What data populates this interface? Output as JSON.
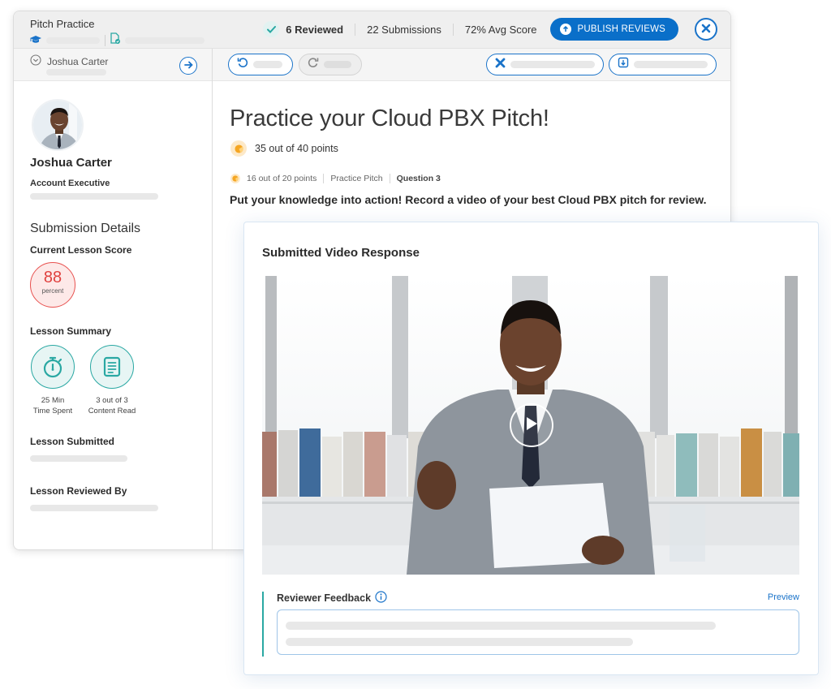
{
  "window": {
    "app_title": "Pitch Practice",
    "breadcrumb_icons": [
      "graduation-cap-icon",
      "document-check-icon"
    ]
  },
  "header_stats": {
    "reviewed": "6 Reviewed",
    "submissions": "22 Submissions",
    "avg_score": "72% Avg Score",
    "publish_label": "PUBLISH REVIEWS",
    "close_icon": "close-icon"
  },
  "sidebar": {
    "learner_select": "Joshua Carter",
    "profile": {
      "name": "Joshua Carter",
      "role": "Account Executive"
    },
    "section_title": "Submission Details",
    "current_score": {
      "label": "Current Lesson Score",
      "value": "88",
      "unit": "percent"
    },
    "summary": {
      "label": "Lesson Summary",
      "items": [
        {
          "icon": "stopwatch-icon",
          "value": "25 Min",
          "caption": "Time Spent"
        },
        {
          "icon": "document-icon",
          "value": "3 out of 3",
          "caption": "Content Read"
        }
      ]
    },
    "submitted_label": "Lesson Submitted",
    "reviewed_by_label": "Lesson Reviewed By"
  },
  "toolbar": {
    "buttons": [
      {
        "icon": "undo-icon",
        "state": "enabled"
      },
      {
        "icon": "redo-icon",
        "state": "disabled"
      },
      {
        "icon": "reject-x-icon",
        "state": "enabled"
      },
      {
        "icon": "download-icon",
        "state": "enabled"
      }
    ]
  },
  "lesson": {
    "title": "Practice your Cloud PBX Pitch!",
    "total_points": "35 out of 40 points",
    "question_points": "16 out of 20 points",
    "question_type": "Practice Pitch",
    "question_number": "Question 3",
    "prompt": "Put your knowledge into action! Record a video of your best Cloud PBX pitch for review."
  },
  "video_card": {
    "title": "Submitted Video Response",
    "feedback_label": "Reviewer Feedback",
    "preview_link": "Preview"
  },
  "colors": {
    "primary_blue": "#0a6fc9",
    "teal": "#2aa8a3",
    "score_red": "#e0403e",
    "points_orange": "#f5a623"
  }
}
